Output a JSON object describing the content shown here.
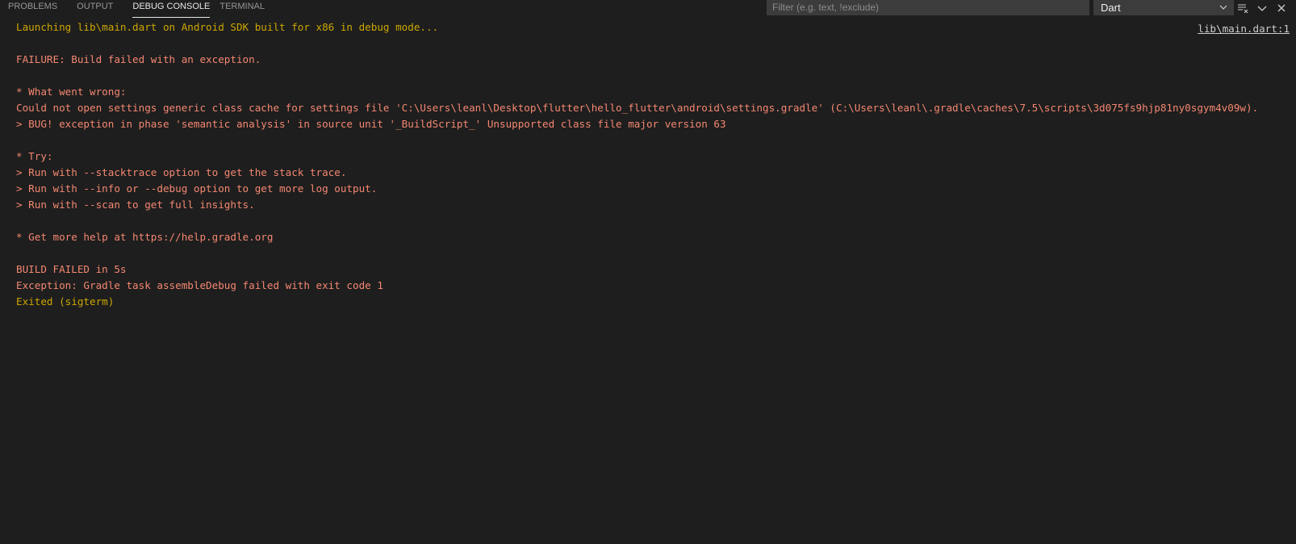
{
  "tabs": [
    {
      "label": "PROBLEMS"
    },
    {
      "label": "OUTPUT"
    },
    {
      "label": "DEBUG CONSOLE"
    },
    {
      "label": "TERMINAL"
    }
  ],
  "filter": {
    "placeholder": "Filter (e.g. text, !exclude)"
  },
  "select": {
    "value": "Dart"
  },
  "actions": {
    "icons": [
      "clear-console-icon",
      "collapse-panel-icon",
      "close-panel-icon"
    ]
  },
  "console": {
    "source_link": "lib\\main.dart:1",
    "lines": [
      {
        "text": "Launching lib\\main.dart on Android SDK built for x86 in debug mode...",
        "level": "warn"
      },
      {
        "text": "",
        "level": "err"
      },
      {
        "text": "FAILURE: Build failed with an exception.",
        "level": "err"
      },
      {
        "text": "",
        "level": "err"
      },
      {
        "text": "* What went wrong:",
        "level": "err"
      },
      {
        "text": "Could not open settings generic class cache for settings file 'C:\\Users\\leanl\\Desktop\\flutter\\hello_flutter\\android\\settings.gradle' (C:\\Users\\leanl\\.gradle\\caches\\7.5\\scripts\\3d075fs9hjp81ny0sgym4v09w).",
        "level": "err"
      },
      {
        "text": "> BUG! exception in phase 'semantic analysis' in source unit '_BuildScript_' Unsupported class file major version 63",
        "level": "err"
      },
      {
        "text": "",
        "level": "err"
      },
      {
        "text": "* Try:",
        "level": "err"
      },
      {
        "text": "> Run with --stacktrace option to get the stack trace.",
        "level": "err"
      },
      {
        "text": "> Run with --info or --debug option to get more log output.",
        "level": "err"
      },
      {
        "text": "> Run with --scan to get full insights.",
        "level": "err"
      },
      {
        "text": "",
        "level": "err"
      },
      {
        "text": "* Get more help at https://help.gradle.org",
        "level": "err"
      },
      {
        "text": "",
        "level": "err"
      },
      {
        "text": "BUILD FAILED in 5s",
        "level": "err"
      },
      {
        "text": "Exception: Gradle task assembleDebug failed with exit code 1",
        "level": "err"
      },
      {
        "text": "Exited (sigterm)",
        "level": "warn"
      }
    ]
  },
  "colors": {
    "background": "#1e1e1e",
    "warning": "#cca700",
    "error": "#f48771",
    "tab_active": "#e7e7e7",
    "tab_inactive": "#969696"
  }
}
